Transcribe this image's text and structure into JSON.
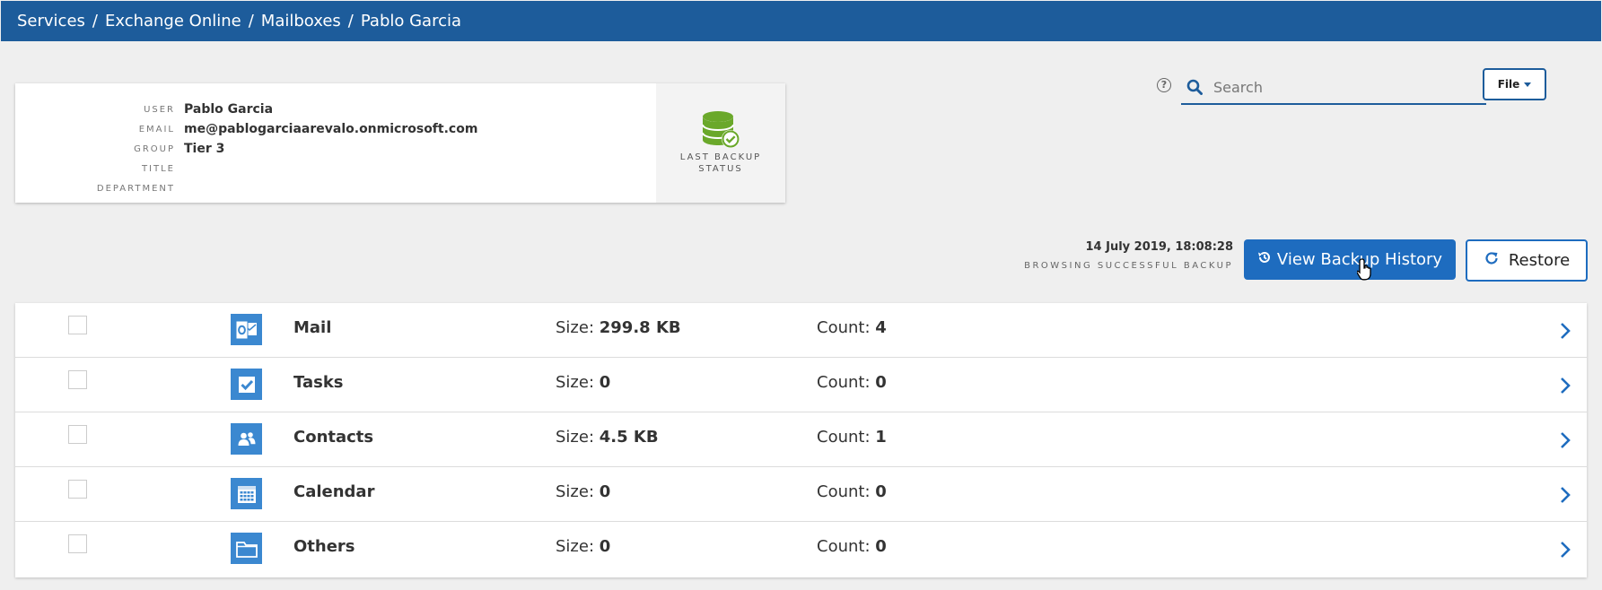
{
  "breadcrumb": [
    "Services",
    "Exchange Online",
    "Mailboxes",
    "Pablo Garcia"
  ],
  "breadcrumb_separator": "/",
  "user": {
    "fields": [
      {
        "label": "USER",
        "value": "Pablo Garcia"
      },
      {
        "label": "EMAIL",
        "value": "me@pablogarciaarevalo.onmicrosoft.com"
      },
      {
        "label": "GROUP",
        "value": "Tier 3"
      },
      {
        "label": "TITLE",
        "value": ""
      },
      {
        "label": "DEPARTMENT",
        "value": ""
      }
    ],
    "last_backup_status_label": "LAST BACKUP STATUS",
    "status_icon": "database-check-icon",
    "status_color": "#6aa82a"
  },
  "search": {
    "placeholder": "Search"
  },
  "file_button": {
    "label": "File"
  },
  "backup": {
    "date": "14 July 2019, 18:08:28",
    "browsing_label": "BROWSING SUCCESSFUL BACKUP"
  },
  "actions": {
    "history_label": "View Backup History",
    "restore_label": "Restore"
  },
  "items": [
    {
      "name": "Mail",
      "size_label": "Size:",
      "size": "299.8 KB",
      "count_label": "Count:",
      "count": "4",
      "icon": "outlook-icon"
    },
    {
      "name": "Tasks",
      "size_label": "Size:",
      "size": "0",
      "count_label": "Count:",
      "count": "0",
      "icon": "task-check-icon"
    },
    {
      "name": "Contacts",
      "size_label": "Size:",
      "size": "4.5 KB",
      "count_label": "Count:",
      "count": "1",
      "icon": "contacts-icon"
    },
    {
      "name": "Calendar",
      "size_label": "Size:",
      "size": "0",
      "count_label": "Count:",
      "count": "0",
      "icon": "calendar-icon"
    },
    {
      "name": "Others",
      "size_label": "Size:",
      "size": "0",
      "count_label": "Count:",
      "count": "0",
      "icon": "folder-icon"
    }
  ],
  "colors": {
    "header": "#1d5c9b",
    "primary_button": "#1e6cbf",
    "item_icon_bg": "#3b88d0"
  }
}
